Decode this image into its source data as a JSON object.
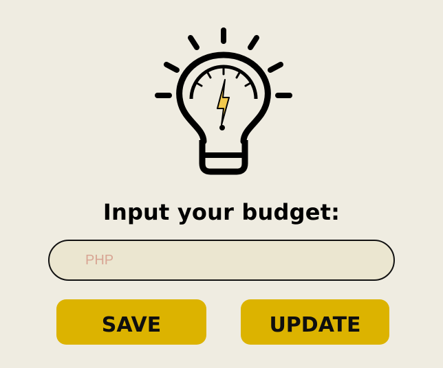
{
  "icon": "lightbulb-icon",
  "colors": {
    "background": "#efece1",
    "input_background": "#ebe6d0",
    "placeholder": "#d8a594",
    "button": "#dcb300",
    "bolt": "#f2c94c"
  },
  "heading": "Input your budget:",
  "budget_input": {
    "placeholder": "PHP",
    "value": ""
  },
  "buttons": {
    "save": "SAVE",
    "update": "UPDATE"
  }
}
